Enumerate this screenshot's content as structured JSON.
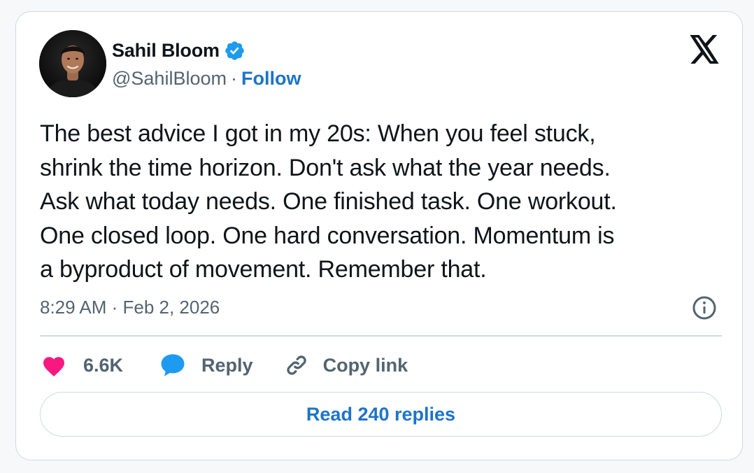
{
  "author": {
    "name": "Sahil Bloom",
    "handle": "@SahilBloom",
    "separator": "·",
    "follow_label": "Follow"
  },
  "icons": {
    "verified": "verified-badge-icon",
    "brand": "x-logo-icon",
    "info": "info-icon",
    "like": "heart-icon",
    "reply": "speech-bubble-icon",
    "copy": "link-icon"
  },
  "tweet": {
    "text": "The best advice I got in my 20s: When you feel stuck,\nshrink the time horizon. Don't ask what the year needs.\nAsk what today needs. One finished task. One workout.\nOne closed loop. One hard conversation. Momentum is\na byproduct of movement. Remember that.",
    "timestamp": "8:29 AM · Feb 2, 2026"
  },
  "actions": {
    "like_count": "6.6K",
    "reply_label": "Reply",
    "copy_label": "Copy link"
  },
  "footer": {
    "read_replies_label": "Read 240 replies"
  },
  "colors": {
    "link_blue": "#1d74c8",
    "verified_blue": "#1d9bf0",
    "like_pink": "#f91880",
    "text_primary": "#0f1419",
    "text_secondary": "#536471",
    "border": "#cfd9de"
  }
}
